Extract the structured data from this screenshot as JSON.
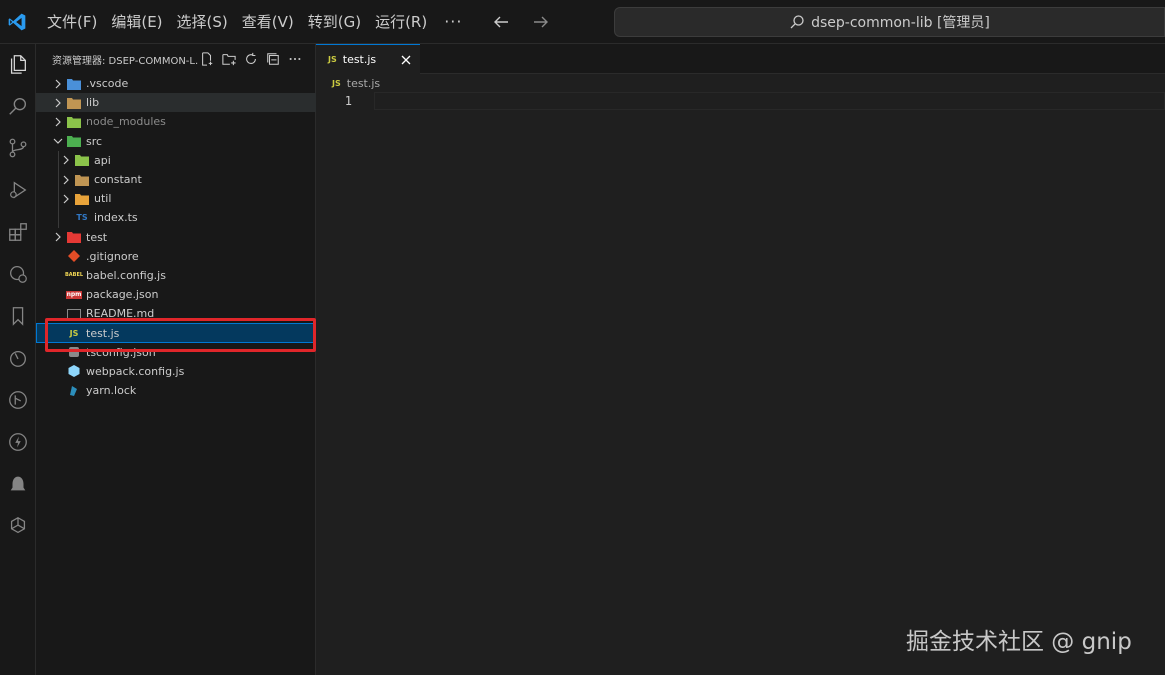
{
  "menu": [
    "文件(F)",
    "编辑(E)",
    "选择(S)",
    "查看(V)",
    "转到(G)",
    "运行(R)"
  ],
  "menu_more": "···",
  "command_center": "dsep-common-lib [管理员]",
  "sidebar": {
    "title": "资源管理器: DSEP-COMMON-L...",
    "tree": [
      {
        "label": ".vscode",
        "depth": 0,
        "chevron": "right",
        "icon": "vscode-folder-icon",
        "color": "#4a90d9"
      },
      {
        "label": "lib",
        "depth": 0,
        "chevron": "right",
        "icon": "lib-folder-icon",
        "color": "#c09553"
      },
      {
        "label": "node_modules",
        "depth": 0,
        "chevron": "right",
        "icon": "node-folder-icon",
        "color": "#8bc34a"
      },
      {
        "label": "src",
        "depth": 0,
        "chevron": "down",
        "icon": "src-folder-icon",
        "color": "#4caf50"
      },
      {
        "label": "api",
        "depth": 1,
        "chevron": "right",
        "icon": "api-folder-icon",
        "color": "#8bc34a"
      },
      {
        "label": "constant",
        "depth": 1,
        "chevron": "right",
        "icon": "folder-icon",
        "color": "#c09553"
      },
      {
        "label": "util",
        "depth": 1,
        "chevron": "right",
        "icon": "util-folder-icon",
        "color": "#e8a33a"
      },
      {
        "label": "index.ts",
        "depth": 1,
        "chevron": "none",
        "icon": "ts-file-icon",
        "badge": "TS",
        "color": "#3178c6"
      },
      {
        "label": "test",
        "depth": 0,
        "chevron": "right",
        "icon": "test-folder-icon",
        "color": "#e53935"
      },
      {
        "label": ".gitignore",
        "depth": 0,
        "chevron": "none",
        "icon": "git-file-icon",
        "color": "#e44d26"
      },
      {
        "label": "babel.config.js",
        "depth": 0,
        "chevron": "none",
        "icon": "babel-file-icon",
        "badge": "BABEL",
        "color": "#f5da55"
      },
      {
        "label": "package.json",
        "depth": 0,
        "chevron": "none",
        "icon": "npm-file-icon",
        "badge": "npm",
        "color": "#cb3837"
      },
      {
        "label": "README.md",
        "depth": 0,
        "chevron": "none",
        "icon": "readme-file-icon",
        "color": "#e44d26"
      },
      {
        "label": "test.js",
        "depth": 0,
        "chevron": "none",
        "icon": "js-file-icon",
        "badge": "JS",
        "color": "#cbcb41",
        "selected": true
      },
      {
        "label": "tsconfig.json",
        "depth": 0,
        "chevron": "none",
        "icon": "tsconfig-file-icon",
        "color": "#3178c6"
      },
      {
        "label": "webpack.config.js",
        "depth": 0,
        "chevron": "none",
        "icon": "webpack-file-icon",
        "color": "#8ed6fb"
      },
      {
        "label": "yarn.lock",
        "depth": 0,
        "chevron": "none",
        "icon": "yarn-file-icon",
        "color": "#2c8ebb"
      }
    ]
  },
  "editor": {
    "tab": {
      "badge": "JS",
      "label": "test.js"
    },
    "breadcrumb": {
      "badge": "JS",
      "label": "test.js"
    },
    "line_number": "1"
  },
  "watermark": "掘金技术社区 @ gnip",
  "colors": {
    "accent": "#0078d4",
    "selection": "#04395e",
    "highlight": "#e0262a",
    "js": "#cbcb41"
  }
}
